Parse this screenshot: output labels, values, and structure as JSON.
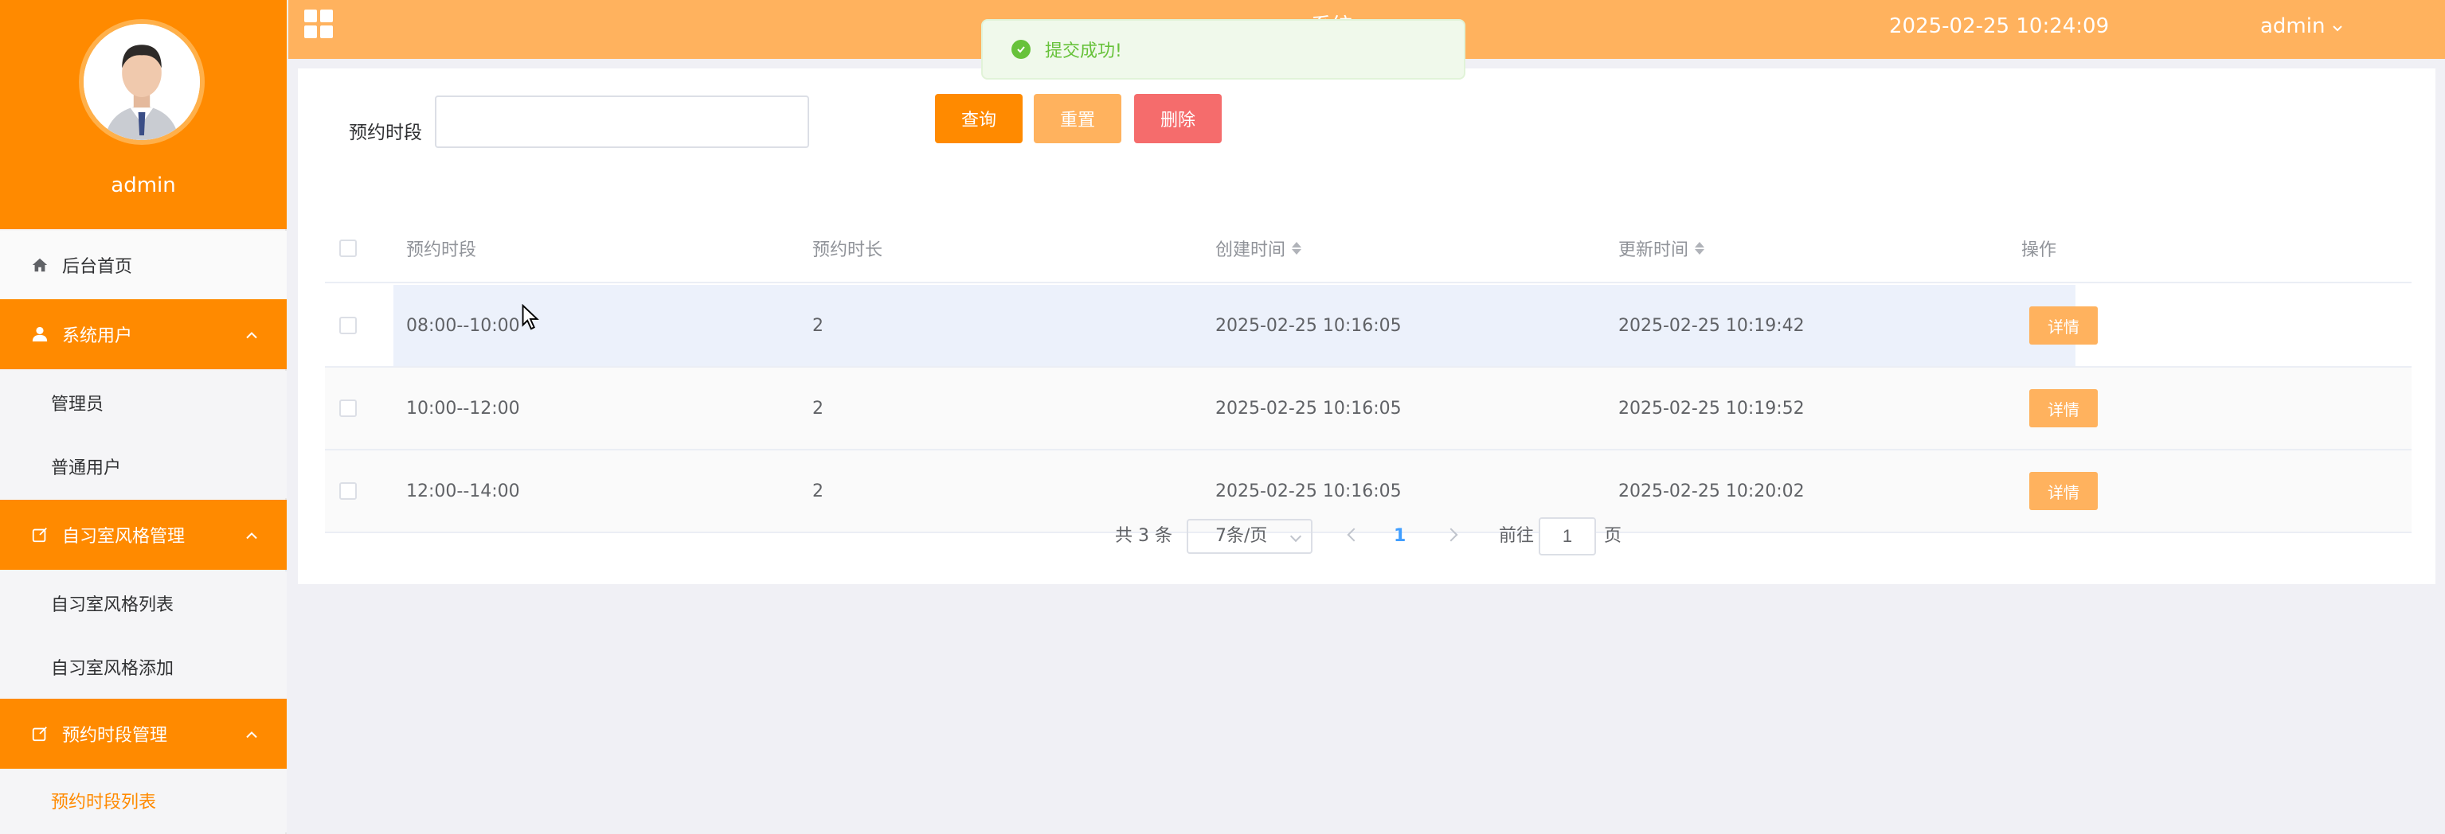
{
  "sidebar": {
    "user_name": "admin",
    "home": "后台首页",
    "groups": [
      {
        "label": "系统用户",
        "items": [
          "管理员",
          "普通用户"
        ]
      },
      {
        "label": "自习室风格管理",
        "items": [
          "自习室风格列表",
          "自习室风格添加"
        ]
      },
      {
        "label": "预约时段管理",
        "items": [
          "预约时段列表"
        ]
      }
    ]
  },
  "topbar": {
    "title": "…………系统",
    "datetime": "2025-02-25 10:24:09",
    "user": "admin"
  },
  "toast": {
    "message": "提交成功!"
  },
  "search": {
    "label": "预约时段",
    "value": ""
  },
  "buttons": {
    "query": "查询",
    "reset": "重置",
    "delete": "删除",
    "detail": "详情"
  },
  "table": {
    "headers": [
      "预约时段",
      "预约时长",
      "创建时间",
      "更新时间",
      "操作"
    ],
    "rows": [
      {
        "slot": "08:00--10:00",
        "duration": "2",
        "created": "2025-02-25 10:16:05",
        "updated": "2025-02-25 10:19:42"
      },
      {
        "slot": "10:00--12:00",
        "duration": "2",
        "created": "2025-02-25 10:16:05",
        "updated": "2025-02-25 10:19:52"
      },
      {
        "slot": "12:00--14:00",
        "duration": "2",
        "created": "2025-02-25 10:16:05",
        "updated": "2025-02-25 10:20:02"
      }
    ]
  },
  "pagination": {
    "total": "共 3 条",
    "page_size": "7条/页",
    "current_page": "1",
    "goto_label": "前往",
    "goto_value": "1",
    "page_unit": "页"
  },
  "colors": {
    "primary": "#ff8a00",
    "light": "#ffb25e",
    "danger": "#f56c6c",
    "success": "#67c23a"
  }
}
